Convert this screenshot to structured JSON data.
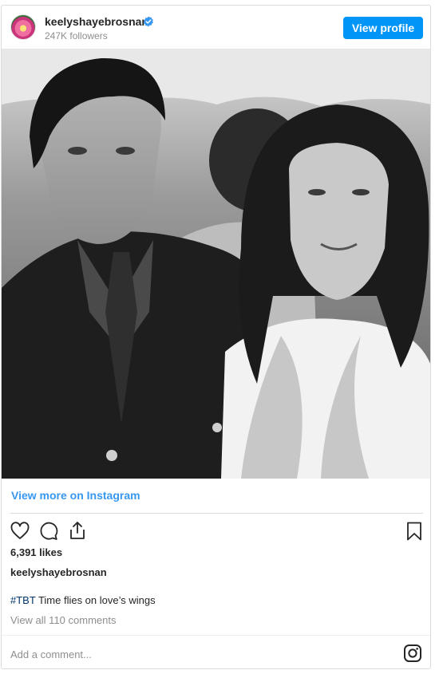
{
  "header": {
    "username": "keelyshayebrosnan",
    "followers": "247K followers",
    "view_profile_label": "View profile"
  },
  "post": {
    "photo_icon": "photo-placeholder",
    "view_more_label": "View more on Instagram",
    "likes": "6,391 likes",
    "poster": "keelyshayebrosnan",
    "caption_hashtag": "#TBT",
    "caption_text": " Time flies on love’s wings",
    "comments_link": "View all 110 comments",
    "add_comment_placeholder": "Add a comment..."
  },
  "icons": {
    "like": "heart-icon",
    "comment": "comment-icon",
    "share": "share-icon",
    "save": "bookmark-icon",
    "verified": "verified-badge-icon",
    "brand": "instagram-icon"
  },
  "colors": {
    "accent": "#0095f6",
    "link": "#3897f0",
    "hashtag": "#003569",
    "muted": "#8e8e8e"
  }
}
